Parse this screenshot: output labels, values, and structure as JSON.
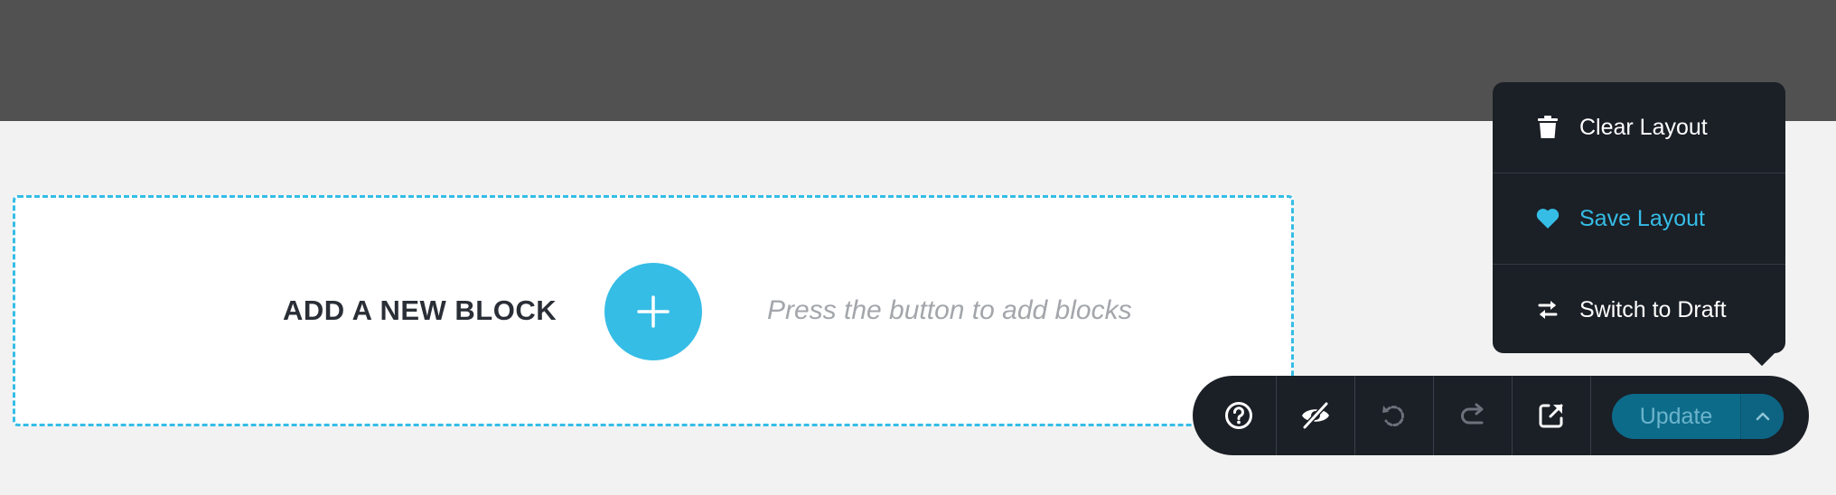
{
  "dropzone": {
    "title": "ADD A NEW BLOCK",
    "hint": "Press the button to add blocks",
    "add_icon": "plus-icon"
  },
  "menu": {
    "items": [
      {
        "label": "Clear Layout",
        "icon": "trash-icon"
      },
      {
        "label": "Save Layout",
        "icon": "heart-icon"
      },
      {
        "label": "Switch to Draft",
        "icon": "swap-arrows-icon"
      }
    ]
  },
  "toolbar": {
    "buttons": [
      {
        "icon": "help-icon"
      },
      {
        "icon": "eye-off-icon"
      },
      {
        "icon": "undo-icon"
      },
      {
        "icon": "redo-icon"
      },
      {
        "icon": "external-link-icon"
      }
    ],
    "update_label": "Update",
    "update_caret_icon": "chevron-up-icon"
  },
  "colors": {
    "accent": "#35bde6",
    "dark": "#1b1f26",
    "header": "#515151",
    "canvas": "#f2f2f2"
  }
}
